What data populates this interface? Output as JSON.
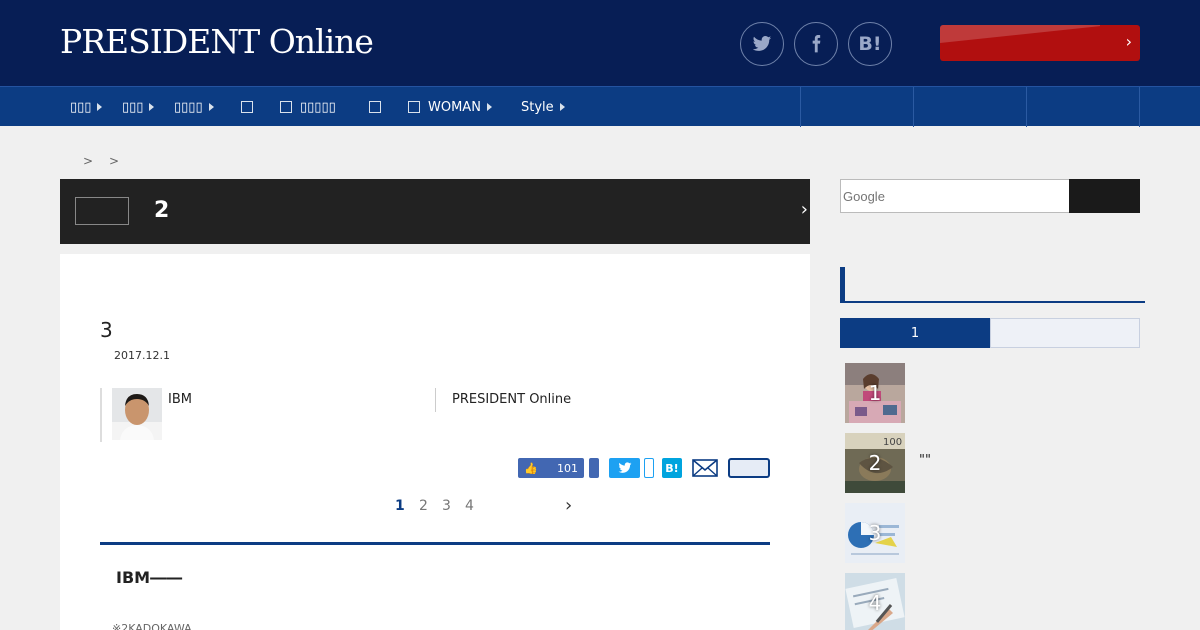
{
  "header": {
    "logo": "PRESIDENT Online",
    "social": {
      "hatena_label": "B!"
    }
  },
  "nav": {
    "items": [
      {
        "label": "▯▯▯"
      },
      {
        "label": "▯▯▯"
      },
      {
        "label": "▯▯▯▯"
      },
      {
        "label": ""
      },
      {
        "label": "▯▯▯▯▯"
      },
      {
        "label": ""
      },
      {
        "label": "WOMAN"
      },
      {
        "label": "Style"
      }
    ]
  },
  "breadcrumb": {
    "sep1": ">",
    "sep2": ">"
  },
  "page_banner": {
    "number": "2"
  },
  "article": {
    "title": "3",
    "date": "2017.12.1",
    "author": "IBM",
    "publisher": "PRESIDENT Online",
    "like_count": "101",
    "hatena_label": "B!",
    "pages": [
      "1",
      "2",
      "3",
      "4"
    ],
    "current_page": "1",
    "lead": "IBM――",
    "note": "※2KADOKAWA"
  },
  "sidebar": {
    "search_placeholder": "Google",
    "tab_active": "1",
    "ranking": [
      {
        "rank": "1",
        "text": ""
      },
      {
        "rank": "2",
        "text": "\"\""
      },
      {
        "rank": "3",
        "text": ""
      },
      {
        "rank": "4",
        "text": ""
      }
    ]
  },
  "colors": {
    "header_bg": "#071e55",
    "nav_bg": "#0c3c83",
    "cta_red": "#b10f0f",
    "accent": "#0c3c83"
  }
}
